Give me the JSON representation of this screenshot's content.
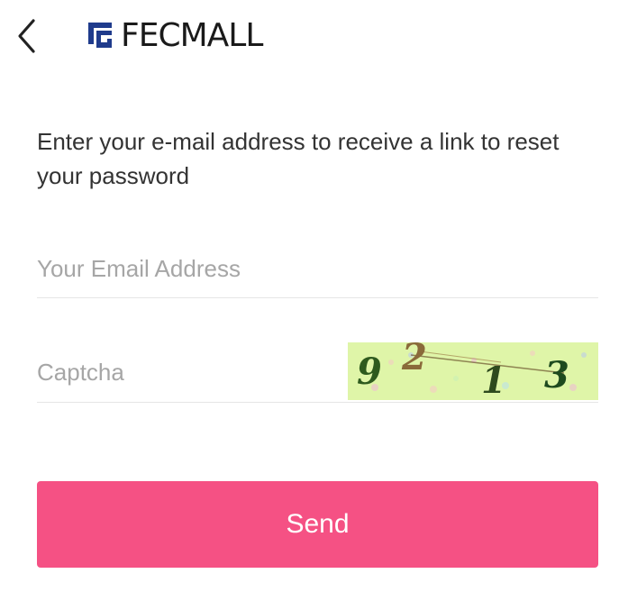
{
  "header": {
    "back_icon": "chevron-left-icon",
    "logo_text": "FECMALL",
    "logo_color": "#1f3b8c"
  },
  "intro": {
    "text": "Enter your e-mail address to receive a link to reset your password"
  },
  "form": {
    "email": {
      "placeholder": "Your Email Address",
      "value": ""
    },
    "captcha": {
      "placeholder": "Captcha",
      "value": "",
      "image_text": "92 13",
      "image_background": "#dff5a8"
    },
    "send_label": "Send",
    "send_color": "#f55184"
  }
}
